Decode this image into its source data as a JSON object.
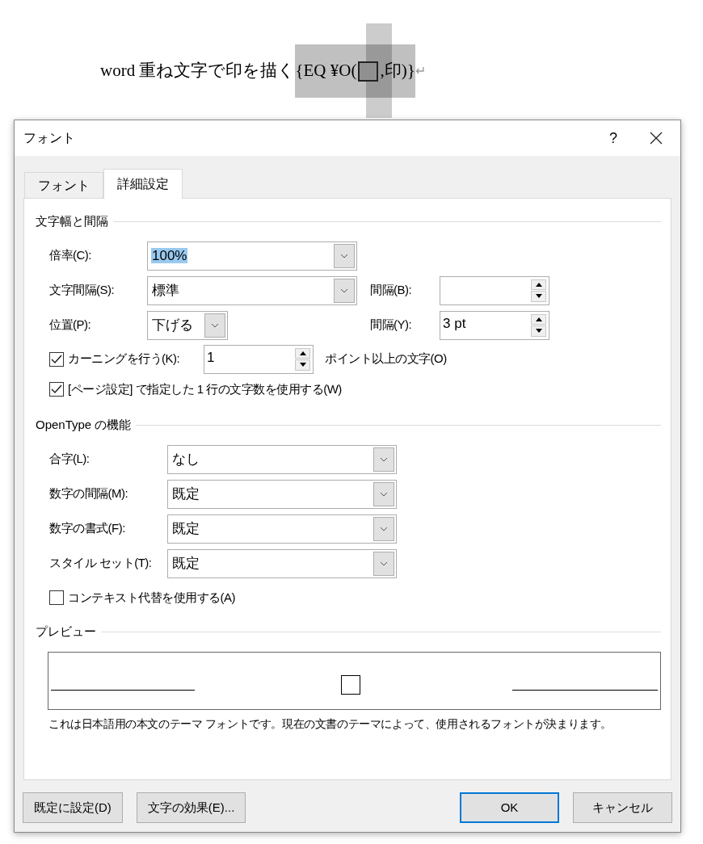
{
  "document": {
    "text": "word 重ね文字で印を描く",
    "field_before": "{EQ ¥O(",
    "field_after": ",印)}",
    "paragraph_mark": "↵"
  },
  "dialog": {
    "title": "フォント",
    "help": "?",
    "tabs": [
      {
        "label": "フォント",
        "selected": false
      },
      {
        "label": "詳細設定",
        "selected": true
      }
    ],
    "spacing_section": {
      "heading": "文字幅と間隔",
      "scale": {
        "label": "倍率(C):",
        "value": "100%",
        "value_selected": true
      },
      "char_spacing": {
        "label": "文字間隔(S):",
        "value": "標準"
      },
      "spacing_by": {
        "label": "間隔(B):"
      },
      "position": {
        "label": "位置(P):",
        "value": "下げる"
      },
      "position_by": {
        "label": "間隔(Y):",
        "value": "3 pt"
      },
      "kerning": {
        "label": "カーニングを行う(K):",
        "checked": true,
        "value": "1",
        "suffix": "ポイント以上の文字(O)"
      },
      "grid": {
        "label": "[ページ設定] で指定した 1 行の文字数を使用する(W)",
        "checked": true
      }
    },
    "opentype_section": {
      "heading": "OpenType の機能",
      "combos": [
        {
          "label": "合字(L):",
          "value": "なし"
        },
        {
          "label": "数字の間隔(M):",
          "value": "既定"
        },
        {
          "label": "数字の書式(F):",
          "value": "既定"
        },
        {
          "label": "スタイル セット(T):",
          "value": "既定"
        }
      ],
      "contextual": {
        "label": "コンテキスト代替を使用する(A)",
        "checked": false
      }
    },
    "preview_section": {
      "heading": "プレビュー",
      "description": "これは日本語用の本文のテーマ フォントです。現在の文書のテーマによって、使用されるフォントが決まります。"
    },
    "buttons": [
      {
        "label": "既定に設定(D)",
        "default": false
      },
      {
        "label": "文字の効果(E)...",
        "default": false
      },
      {
        "label": "OK",
        "default": true
      },
      {
        "label": "キャンセル",
        "default": false
      }
    ]
  }
}
